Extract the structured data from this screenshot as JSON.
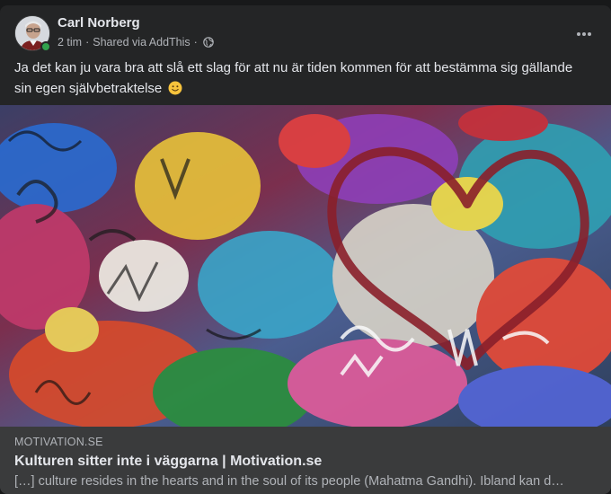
{
  "post": {
    "author": "Carl Norberg",
    "time": "2 tim",
    "separator": "·",
    "shared_via": "Shared via AddThis",
    "separator2": "·",
    "text": "Ja det kan ju vara bra att slå ett slag för att nu är tiden kommen för att bestämma sig gällande sin egen självbetraktelse",
    "emoji_icon": "slightly-smiling-face-icon",
    "avatar_icon": "user-avatar-photo",
    "privacy_icon": "globe-icon",
    "menu_icon": "more-horizontal-icon"
  },
  "link": {
    "image_icon": "graffiti-wall-photo",
    "domain": "MOTIVATION.SE",
    "title": "Kulturen sitter inte i väggarna | Motivation.se",
    "description": "[…] culture resides in the hearts and in the soul of its people (Mahatma Gandhi). Ibland kan d…"
  },
  "colors": {
    "card": "#242526",
    "preview": "#3a3b3c",
    "text_primary": "#e4e6eb",
    "text_secondary": "#b0b3b8",
    "online": "#31a24c"
  }
}
